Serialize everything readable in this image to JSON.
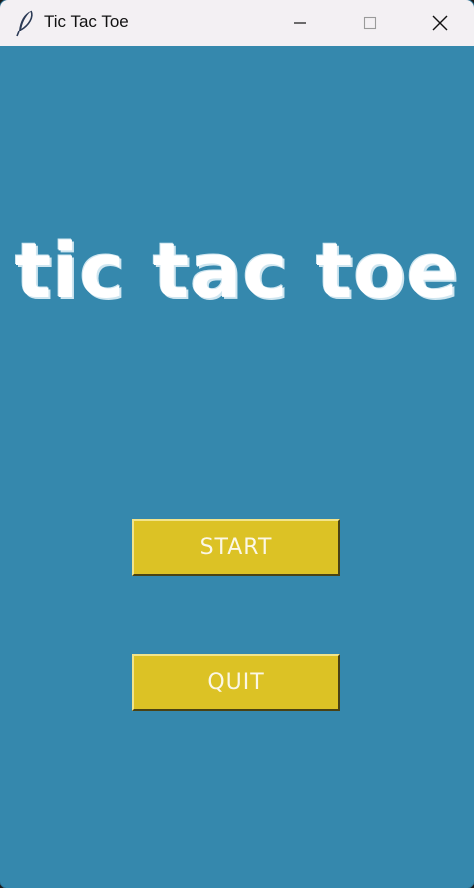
{
  "window": {
    "title": "Tic Tac Toe",
    "app_icon": "feather-icon",
    "controls": [
      "minimize-icon",
      "maximize-icon",
      "close-icon"
    ]
  },
  "game": {
    "title": "tic tac toe",
    "start_label": "START",
    "quit_label": "QUIT"
  },
  "colors": {
    "background": "#3588ad",
    "button": "#dcc225",
    "title_text": "#ffffff",
    "titlebar": "#f3f0f3"
  }
}
